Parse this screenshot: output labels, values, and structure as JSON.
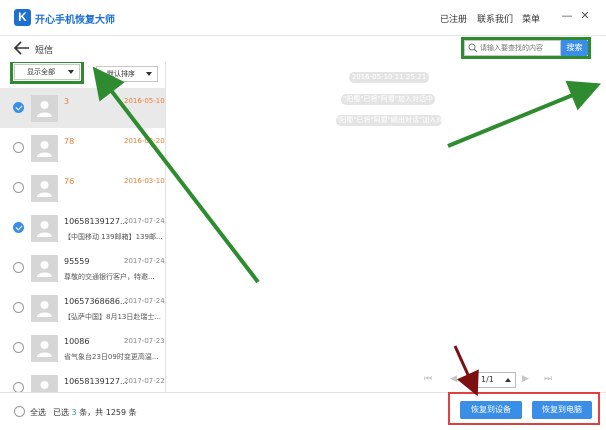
{
  "app": {
    "title": "开心手机恢复大师",
    "logo_letter": "K",
    "links": {
      "registered": "已注册",
      "contact": "联系我们",
      "menu": "菜单"
    }
  },
  "page": {
    "title": "短信"
  },
  "search": {
    "placeholder": "请输入要查找的内容",
    "button": "搜索"
  },
  "filters": {
    "show": "显示全部",
    "sort": "默认排序"
  },
  "messages": [
    {
      "name": "3",
      "date": "2016-05-10",
      "preview": "",
      "checked": true,
      "highlight": true
    },
    {
      "name": "78",
      "date": "2016-03-20",
      "preview": "",
      "checked": false,
      "highlight": true
    },
    {
      "name": "76",
      "date": "2016-03-10",
      "preview": "",
      "checked": false,
      "highlight": true
    },
    {
      "name": "10658139127...",
      "date": "2017-07-24",
      "preview": "【中国移动 139邮箱】139邮...",
      "checked": true,
      "highlight": false
    },
    {
      "name": "95559",
      "date": "2017-07-24",
      "preview": "尊敬的交通银行客户，特邀...",
      "checked": false,
      "highlight": false
    },
    {
      "name": "10657368686...",
      "date": "2017-07-24",
      "preview": "【弘萨中国】8月13日赴瑞士...",
      "checked": false,
      "highlight": false
    },
    {
      "name": "10086",
      "date": "2017-07-23",
      "preview": "省气象台23日09时变更高温...",
      "checked": false,
      "highlight": false
    },
    {
      "name": "10658139127...",
      "date": "2017-07-22",
      "preview": "",
      "checked": false,
      "highlight": false
    }
  ],
  "conversation": {
    "timestamp": "2016-05-10 11:25:21",
    "notices": [
      "\"阳蜀\"已将\"阿蜀\"加入对话中",
      "\"阳蜀\"已将\"阿蜀\"踢出对话\"加入对话中"
    ]
  },
  "pager": {
    "value": "1/1"
  },
  "footer": {
    "select_all": "全选",
    "selected_prefix": "已选",
    "selected_count": "3",
    "selected_suffix": "条，共 1259 条",
    "recover_device": "恢复到设备",
    "recover_pc": "恢复到电脑"
  },
  "colors": {
    "accent": "#3a8ee6",
    "highlight": "#e8803a",
    "annotation_green": "#2f8b2f",
    "annotation_red": "#e0403e"
  }
}
